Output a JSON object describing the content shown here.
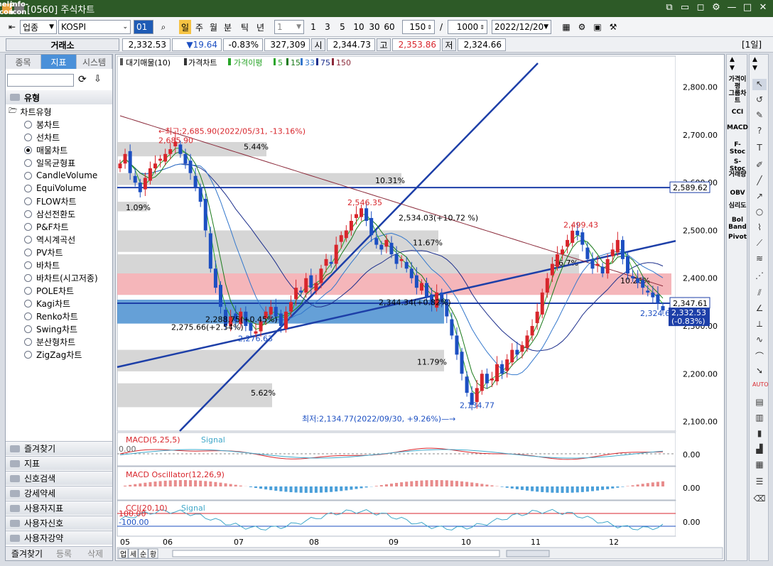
{
  "window": {
    "title": "[0560] 주식차트",
    "icons": [
      "help-icon",
      "info-icon"
    ],
    "controls": [
      "restore-icon",
      "minimize-icon",
      "maximize-icon",
      "close-icon"
    ]
  },
  "toolbar": {
    "market": "업종",
    "index": "KOSPI",
    "code_icon": "01",
    "period_buttons": [
      "일",
      "주",
      "월",
      "분",
      "틱",
      "년"
    ],
    "active_period": "일",
    "minute_select": "1",
    "minute_buttons": [
      "1",
      "3",
      "5",
      "10",
      "30",
      "60"
    ],
    "count": "150",
    "count_sep": "/",
    "max_count": "1000",
    "date": "2022/12/20"
  },
  "quote": {
    "exchange": "거래소",
    "price": "2,332.53",
    "change": "▼19.64",
    "change_pct": "-0.83%",
    "volume": "327,309",
    "open_label": "시",
    "open": "2,344.73",
    "high_label": "고",
    "high": "2,353.86",
    "low_label": "저",
    "low": "2,324.66",
    "period_badge": "[1일]"
  },
  "left_panel": {
    "tabs": [
      "종목",
      "지표",
      "시스템"
    ],
    "active_tab": "지표",
    "section": "유형",
    "group": "차트유형",
    "chart_types": [
      "봉차트",
      "선차트",
      "매물차트",
      "일목균형표",
      "CandleVolume",
      "EquiVolume",
      "FLOW차트",
      "삼선전환도",
      "P&F차트",
      "역시계곡선",
      "PV차트",
      "바차트",
      "바차트(시고저종)",
      "POLE차트",
      "Kagi차트",
      "Renko차트",
      "Swing차트",
      "분산형차트",
      "ZigZag차트"
    ],
    "selected_type": "매물차트",
    "folders": [
      "즐겨찾기",
      "지표",
      "신호검색",
      "강세약세",
      "사용자지표",
      "사용자신호",
      "사용자강약"
    ],
    "bottom_tabs": [
      "즐겨찾기",
      "등록",
      "삭제"
    ]
  },
  "chart": {
    "legend": {
      "vol_profile": "대기매물(10)",
      "price": "가격차트",
      "ma_label": "가격이평",
      "ma5": "5",
      "ma15": "15",
      "ma33": "33",
      "ma75": "75",
      "ma150": "150"
    },
    "y_labels": [
      "2,800.00",
      "2,700.00",
      "2,600.00",
      "2,500.00",
      "2,400.00",
      "2,300.00",
      "2,200.00",
      "2,100.00"
    ],
    "x_labels": [
      "05",
      "06",
      "07",
      "08",
      "09",
      "10",
      "11",
      "12"
    ],
    "annotations": {
      "high": "←최고:2,685.90(2022/05/31, -13.16%)",
      "high_val": "2,685.90",
      "low": "최저:2,134.77(2022/09/30, +9.26%)—→",
      "low_val": "2,134.77",
      "p2546": "2,546.35",
      "p2534": "2,534.03(+10.72 %)",
      "p2499": "2,499.43",
      "p2344": "2,344.34(+0.82%)",
      "p2288": "2,288.75(+0.45%)",
      "p2275": "2,275.66(+2.54%)",
      "p2276": "2,276.63",
      "p2324": "2,324.66"
    },
    "profile_pcts": [
      "5.44%",
      "10.31%",
      "1.09%",
      "11.67%",
      "16.7%",
      "11.79%",
      "5.62%",
      "10.26%"
    ],
    "price_tags": {
      "line1": "2,589.62",
      "current": "2,347.61",
      "last": "2,332.53",
      "last_pct": "(-0.83%)"
    },
    "macd": {
      "title": "MACD(5,25,5)",
      "signal": "Signal",
      "left_val": "0.00",
      "right_val": "0.00"
    },
    "osc": {
      "title": "MACD Oscillator(12,26,9)",
      "right_val": "0.00"
    },
    "cci": {
      "title": "CCI(20,10)",
      "signal": "Signal",
      "top": "100.00",
      "bottom": "-100.00",
      "right_val": "0.00"
    },
    "bottom_tabs": [
      "업",
      "세",
      "순",
      "황"
    ],
    "colors": {
      "up": "#d8262c",
      "down": "#1c4fc2",
      "ma5": "#2aa52a",
      "ma15": "#1a7a1a",
      "ma33": "#3377cc",
      "ma75": "#1d2f8c",
      "ma150": "#8b2a3a",
      "band_red": "#f3a9ae",
      "band_blue": "#4a8fd0",
      "band_gray": "#cfcfcf"
    }
  },
  "right_tools": {
    "indicators": [
      "가격이평",
      "그룹차트",
      "CCI",
      "MACD",
      "F-Stoc",
      "S-Stoc",
      "거래량",
      "OBV",
      "심리도",
      "Bol Band",
      "Pivot"
    ]
  },
  "chart_data": {
    "type": "candlestick",
    "x": [
      "05",
      "06",
      "07",
      "08",
      "09",
      "10",
      "11",
      "12"
    ],
    "ylim": [
      2080,
      2850
    ],
    "close": [
      2640,
      2660,
      2620,
      2600,
      2580,
      2610,
      2630,
      2640,
      2650,
      2660,
      2670,
      2685.9,
      2660,
      2640,
      2620,
      2590,
      2560,
      2500,
      2420,
      2380,
      2340,
      2300,
      2320,
      2310,
      2330,
      2300,
      2290,
      2288.75,
      2310,
      2330,
      2340,
      2320,
      2300,
      2330,
      2350,
      2380,
      2370,
      2400,
      2380,
      2390,
      2420,
      2440,
      2430,
      2470,
      2490,
      2500,
      2520,
      2534.03,
      2546.35,
      2520,
      2490,
      2470,
      2460,
      2480,
      2450,
      2430,
      2440,
      2420,
      2400,
      2380,
      2390,
      2360,
      2344.34,
      2370,
      2350,
      2320,
      2280,
      2240,
      2200,
      2160,
      2134.77,
      2170,
      2200,
      2180,
      2190,
      2220,
      2200,
      2230,
      2250,
      2240,
      2260,
      2280,
      2300,
      2330,
      2370,
      2400,
      2430,
      2450,
      2460,
      2480,
      2499.43,
      2490,
      2470,
      2440,
      2420,
      2430,
      2410,
      2440,
      2460,
      2480,
      2440,
      2410,
      2400,
      2390,
      2380,
      2370,
      2360,
      2347.61,
      2332.53
    ]
  }
}
